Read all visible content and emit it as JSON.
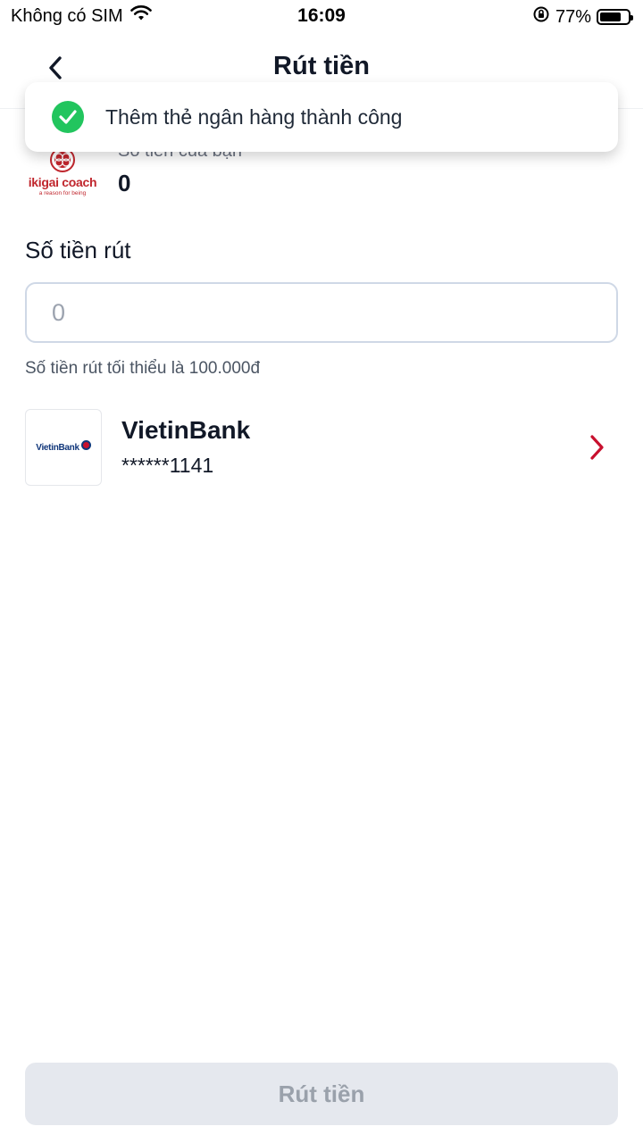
{
  "status_bar": {
    "carrier": "Không có SIM",
    "time": "16:09",
    "battery": "77%",
    "battery_level": 0.77
  },
  "header": {
    "title": "Rút tiền"
  },
  "toast": {
    "message": "Thêm thẻ ngân hàng thành công",
    "icon": "check-circle-icon",
    "color": "#22c55e"
  },
  "balance": {
    "logo_text": "ikigai coach",
    "logo_tagline": "a reason for being",
    "label": "Số tiền của bạn",
    "value": "0"
  },
  "amount": {
    "label": "Số tiền rút",
    "placeholder": "0",
    "hint": "Số tiền rút tối thiểu là 100.000đ"
  },
  "bank": {
    "logo_text": "VietinBank",
    "name": "VietinBank",
    "account": "******1141",
    "accent_color": "#c8102e"
  },
  "footer": {
    "button_label": "Rút tiền"
  }
}
